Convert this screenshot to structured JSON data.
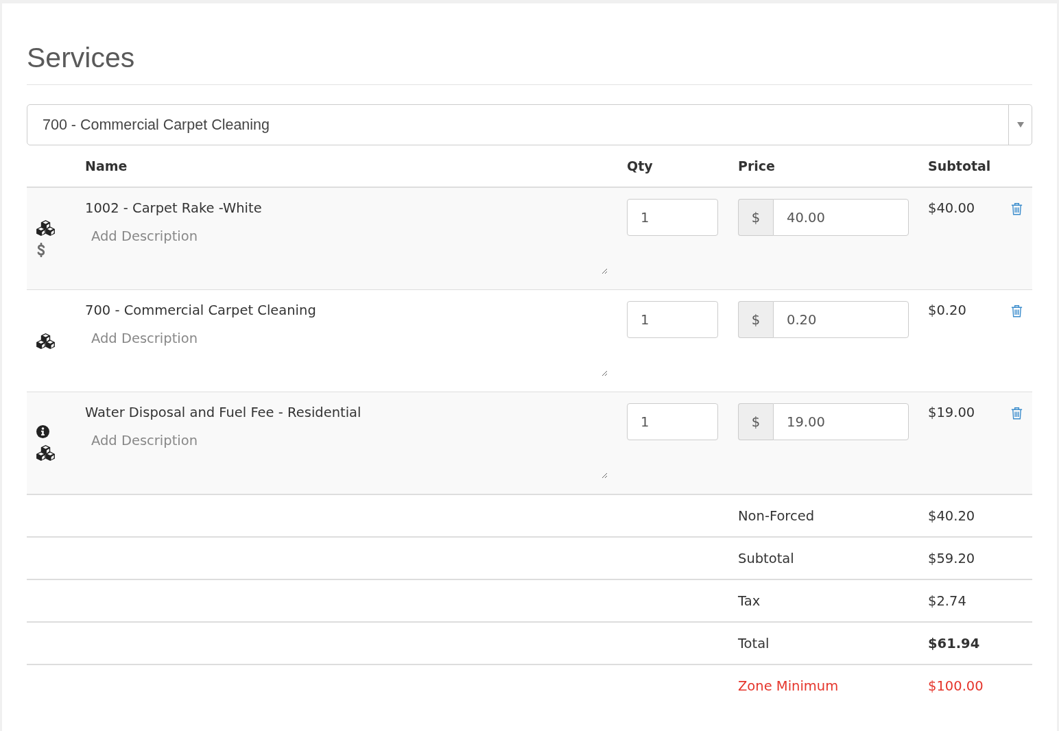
{
  "section": {
    "title": "Services"
  },
  "service_select": {
    "value": "700 - Commercial Carpet Cleaning"
  },
  "line_items": {
    "columns": [
      "Name",
      "Qty",
      "Price",
      "Subtotal"
    ],
    "rows": [
      {
        "indicators": [
          {
            "kind": "product"
          },
          {
            "kind": "price"
          }
        ],
        "name": "1002 - Carpet Rake -White",
        "description": {
          "placeholder": "Add Description"
        },
        "qty": "1",
        "currency": "$",
        "price": "40.00",
        "subtotal": "$40.00"
      },
      {
        "indicators": [
          {
            "kind": "product"
          }
        ],
        "name": "700 - Commercial Carpet Cleaning",
        "description": {
          "placeholder": "Add Description"
        },
        "qty": "1",
        "currency": "$",
        "price": "0.20",
        "subtotal": "$0.20"
      },
      {
        "indicators": [
          {
            "kind": "info"
          },
          {
            "kind": "product"
          }
        ],
        "name": "Water Disposal and Fuel Fee - Residential",
        "description": {
          "placeholder": "Add Description"
        },
        "qty": "1",
        "currency": "$",
        "price": "19.00",
        "subtotal": "$19.00"
      }
    ]
  },
  "summary": [
    {
      "kind": "plain",
      "label": "Non-Forced",
      "value": "$40.20"
    },
    {
      "kind": "plain",
      "label": "Subtotal",
      "value": "$59.20"
    },
    {
      "kind": "plain",
      "label": "Tax",
      "value": "$2.74"
    },
    {
      "kind": "total",
      "label": "Total",
      "value": "$61.94"
    },
    {
      "kind": "alert",
      "label": "Zone Minimum",
      "value": "$100.00"
    }
  ]
}
